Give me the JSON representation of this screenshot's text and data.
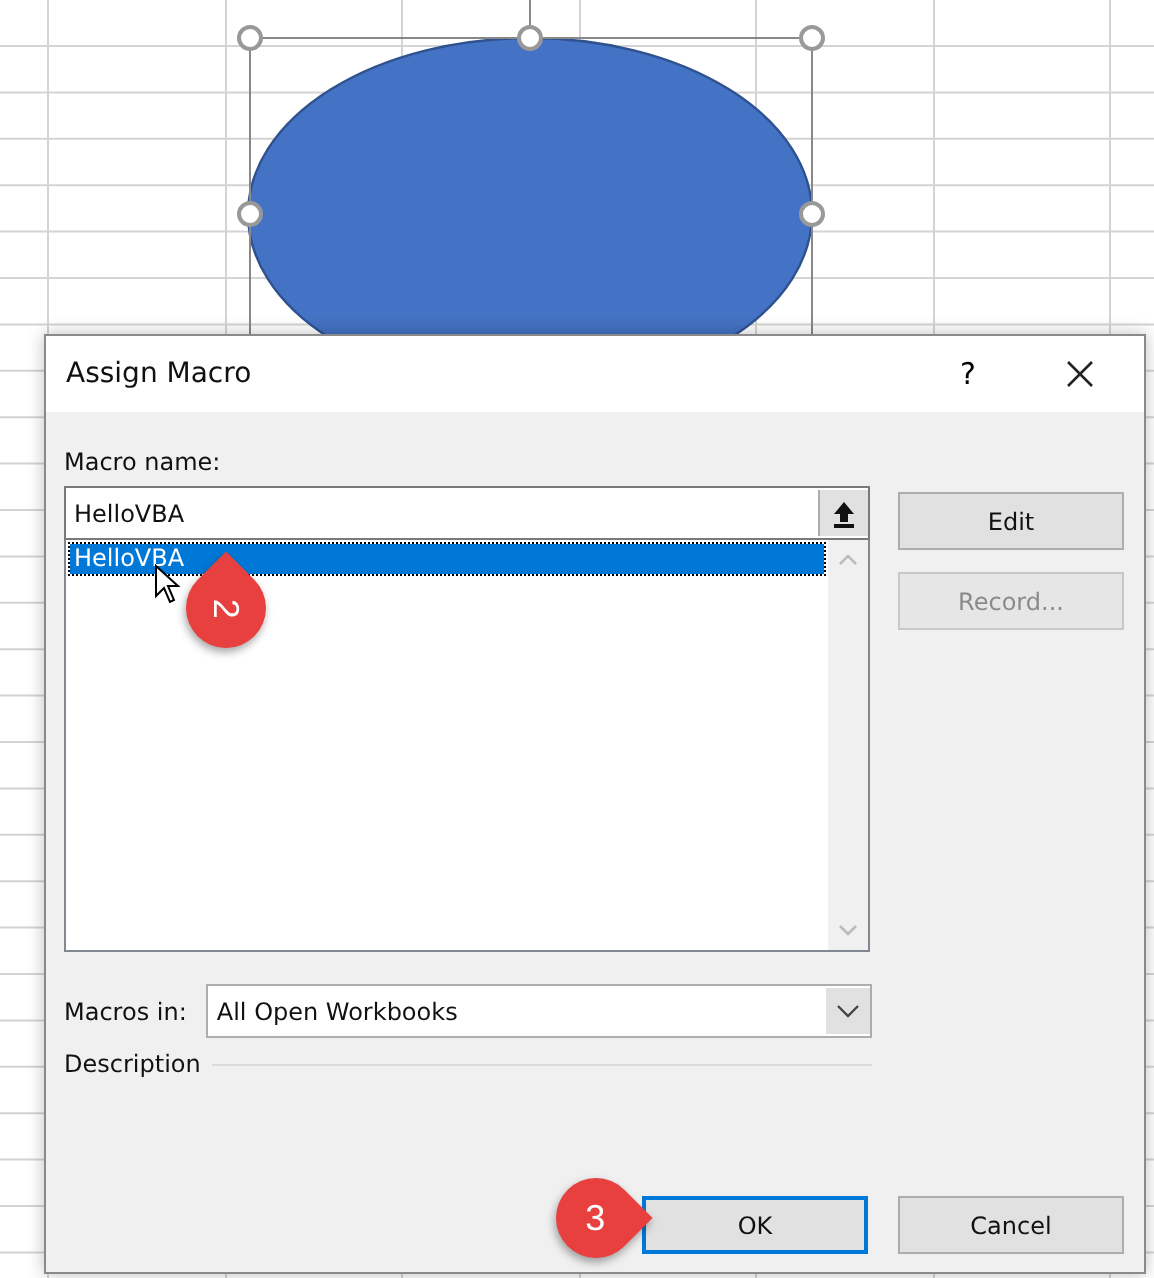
{
  "sheet": {
    "shape": {
      "kind": "oval",
      "selected": true
    }
  },
  "dialog": {
    "title": "Assign Macro",
    "help_button": "?",
    "macro_name": {
      "label": "Macro name:",
      "value": "HelloVBA"
    },
    "macros": [
      {
        "name": "HelloVBA",
        "selected": true
      }
    ],
    "buttons_side": [
      {
        "label": "Edit",
        "disabled": false
      },
      {
        "label": "Record...",
        "disabled": true
      }
    ],
    "macros_in": {
      "label": "Macros in:",
      "value": "All Open Workbooks"
    },
    "description": {
      "label": "Description"
    },
    "buttons_bottom": [
      {
        "label": "OK",
        "default": true
      },
      {
        "label": "Cancel",
        "default": false
      }
    ]
  },
  "callouts": [
    {
      "text": "2",
      "kind": "up"
    },
    {
      "text": "3",
      "kind": "right"
    }
  ]
}
